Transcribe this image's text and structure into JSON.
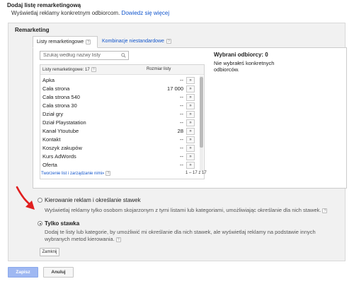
{
  "dialog": {
    "title": "Dodaj listę remarketingową",
    "subtitle": "Wyświetlaj reklamy konkretnym odbiorcom.",
    "learn_more": "Dowiedz się więcej"
  },
  "section": {
    "heading": "Remarketing"
  },
  "tabs": [
    {
      "label": "Listy remarketingowe",
      "help": "?"
    },
    {
      "label": "Kombinacje niestandardowe",
      "help": "?"
    }
  ],
  "search": {
    "placeholder": "Szukaj według nazwy listy",
    "value": ""
  },
  "list": {
    "header_name": "Listy remarketingowe: 17",
    "header_size": "Rozmiar listy",
    "help": "?",
    "add_label": "»",
    "rows": [
      {
        "name": "Apka",
        "size": "--"
      },
      {
        "name": "Cała strona",
        "size": "17 000"
      },
      {
        "name": "Cała strona 540",
        "size": "--"
      },
      {
        "name": "Cała strona 30",
        "size": "--"
      },
      {
        "name": "Dział gry",
        "size": "--"
      },
      {
        "name": "Dział Playstatation",
        "size": "--"
      },
      {
        "name": "Kanał Ytoutube",
        "size": "28"
      },
      {
        "name": "Kontakt",
        "size": "--"
      },
      {
        "name": "Koszyk zakupów",
        "size": "--"
      },
      {
        "name": "Kurs AdWords",
        "size": "--"
      },
      {
        "name": "Oferta",
        "size": "--"
      }
    ],
    "footer_link": "Tworzenie list i zarządzanie nimi»",
    "footer_help": "?",
    "count": "1 – 17 z 17"
  },
  "selected": {
    "title": "Wybrani odbiorcy: 0",
    "empty_text": "Nie wybrałeś konkretnych odbiorców."
  },
  "options": [
    {
      "label": "Kierowanie reklam i określanie stawek",
      "description": "Wyświetlaj reklamy tylko osobom skojarzonym z tymi listami lub kategoriami, umożliwiając określanie dla nich stawek.",
      "help": "?",
      "checked": false
    },
    {
      "label": "Tylko stawka",
      "description": "Dodaj te listy lub kategorie, by umożliwić mi określanie dla nich stawek, ale wyświetlaj reklamy na podstawie innych wybranych metod kierowania.",
      "help": "?",
      "checked": true
    }
  ],
  "buttons": {
    "close": "Zamknij",
    "save": "Zapisz",
    "cancel": "Anuluj"
  },
  "colors": {
    "link": "#1155cc",
    "save_button": "#9fb8f2",
    "arrow": "#e01f1f"
  }
}
